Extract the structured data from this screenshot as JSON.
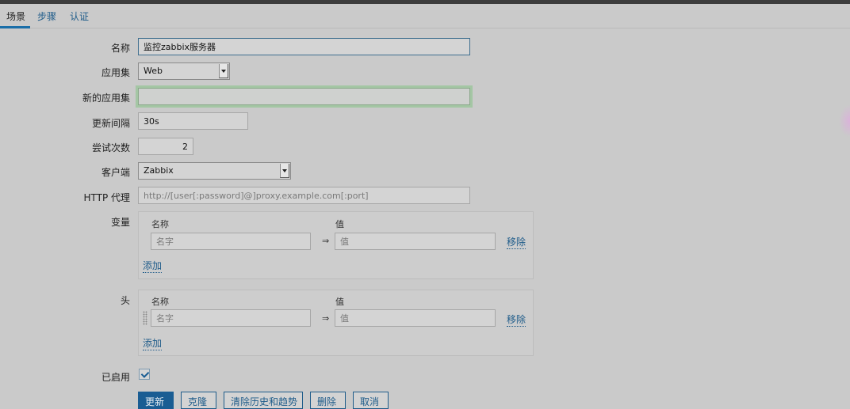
{
  "tabs": [
    {
      "label": "场景"
    },
    {
      "label": "步骤"
    },
    {
      "label": "认证"
    }
  ],
  "form": {
    "name": {
      "label": "名称",
      "value": "监控zabbix服务器"
    },
    "application": {
      "label": "应用集",
      "value": "Web"
    },
    "new_application": {
      "label": "新的应用集",
      "value": ""
    },
    "update_interval": {
      "label": "更新间隔",
      "value": "30s"
    },
    "attempts": {
      "label": "尝试次数",
      "value": "2"
    },
    "agent": {
      "label": "客户端",
      "value": "Zabbix"
    },
    "http_proxy": {
      "label": "HTTP 代理",
      "placeholder": "http://[user[:password]@]proxy.example.com[:port]"
    },
    "variables": {
      "label": "变量",
      "col_name": "名称",
      "col_value": "值",
      "name_placeholder": "名字",
      "value_placeholder": "值",
      "arrow": "⇒",
      "remove": "移除",
      "add": "添加"
    },
    "headers": {
      "label": "头",
      "col_name": "名称",
      "col_value": "值",
      "name_placeholder": "名字",
      "value_placeholder": "值",
      "arrow": "⇒",
      "remove": "移除",
      "add": "添加"
    },
    "enabled": {
      "label": "已启用",
      "checked": true
    }
  },
  "buttons": {
    "update": "更新",
    "clone": "克隆",
    "clear_history": "清除历史和趋势",
    "delete": "删除",
    "cancel": "取消"
  },
  "colors": {
    "accent": "#1a5d93",
    "link": "#1f5c8a",
    "background": "#cacaca"
  }
}
